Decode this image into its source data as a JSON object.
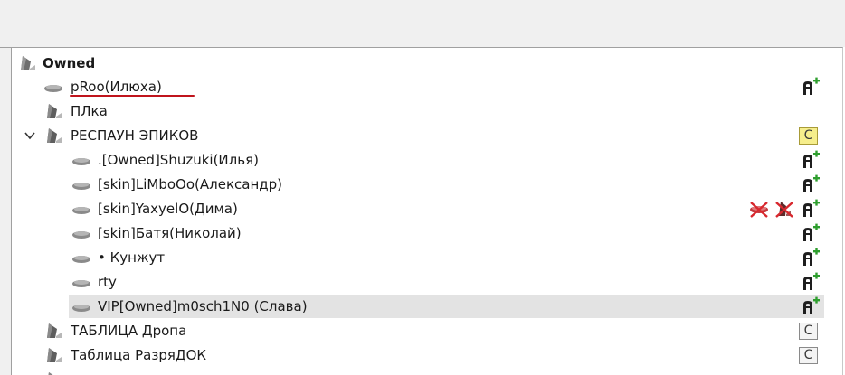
{
  "tree": {
    "root": {
      "label": "Owned"
    },
    "items": [
      {
        "label": "pRoo(Илюха)",
        "type": "user",
        "highlighted": true
      },
      {
        "label": "ПЛка",
        "type": "channel"
      },
      {
        "label": "РЕСПАУН ЭПИКОВ",
        "type": "channel",
        "expanded": true,
        "badge": "C"
      },
      {
        "label": ".[Owned]Shuzuki(Илья)",
        "type": "user"
      },
      {
        "label": "[skin]LiMboOo(Александр)",
        "type": "user"
      },
      {
        "label": "[skin]YaxyelO(Дима)",
        "type": "user",
        "status": [
          "speakers-muted-icon",
          "mic-muted-icon"
        ]
      },
      {
        "label": "[skin]Батя(Николай)",
        "type": "user"
      },
      {
        "label": "• Кунжут",
        "type": "user"
      },
      {
        "label": "rty",
        "type": "user"
      },
      {
        "label": "VIP[Owned]m0sch1N0 (Слава)",
        "type": "user",
        "selected": true
      },
      {
        "label": "ТАБЛИЦА Дропа",
        "type": "channel",
        "badge": "C"
      },
      {
        "label": "Таблица РазряДОК",
        "type": "channel",
        "badge": "C"
      }
    ]
  },
  "colors": {
    "selection": "#e3e3e3",
    "underline": "#c0141c",
    "badge_yellow": "#f6ee8c",
    "icon_plus": "#2e9e2e",
    "muted_red": "#d8282e"
  }
}
